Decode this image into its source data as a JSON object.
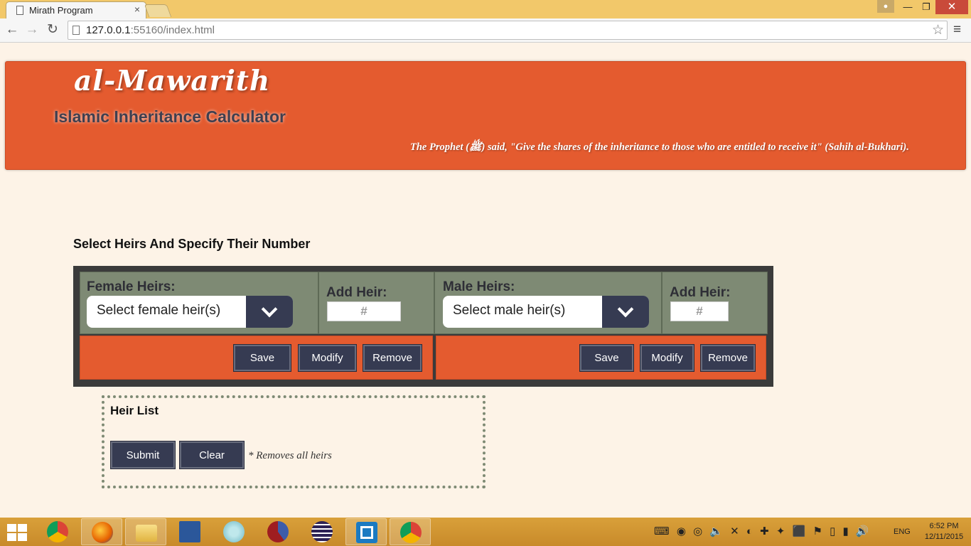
{
  "browser": {
    "tab_title": "Mirath Program",
    "tab_close": "×",
    "url_host": "127.0.0.1",
    "url_rest": ":55160/index.html",
    "win_min": "—",
    "win_max": "❐",
    "win_close": "✕"
  },
  "banner": {
    "brand": "al-Mawarith",
    "subtitle": "Islamic Inheritance Calculator",
    "quote": "The Prophet (ﷺ) said, \"Give the shares of the inheritance to those who are entitled to receive it\" (Sahih al-Bukhari)."
  },
  "heirs": {
    "section_title": "Select Heirs And Specify Their Number",
    "female": {
      "label": "Female Heirs:",
      "select_value": "Select female heir(s)",
      "add_label": "Add Heir:",
      "number_placeholder": "#"
    },
    "male": {
      "label": "Male Heirs:",
      "select_value": "Select male heir(s)",
      "add_label": "Add Heir:",
      "number_placeholder": "#"
    },
    "save_label": "Save",
    "modify_label": "Modify",
    "remove_label": "Remove"
  },
  "heir_list": {
    "title": "Heir List",
    "submit_label": "Submit",
    "clear_label": "Clear",
    "note": "* Removes all heirs"
  },
  "taskbar": {
    "language": "ENG",
    "time": "6:52 PM",
    "date": "12/11/2015"
  },
  "colors": {
    "banner": "#e45b2f",
    "panel_gray": "#7e8a74",
    "button_navy": "#363b52",
    "page_bg": "#fdf3e7"
  }
}
